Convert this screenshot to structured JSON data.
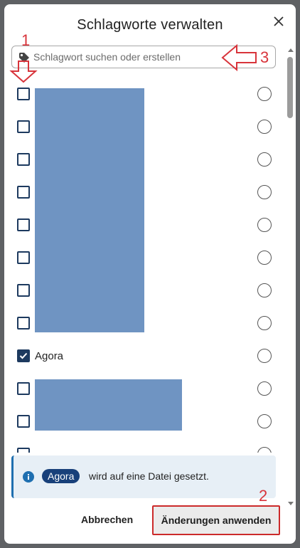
{
  "dialog": {
    "title": "Schlagworte verwalten",
    "close_icon": "close-icon"
  },
  "search": {
    "placeholder": "Schlagwort suchen oder erstellen",
    "icon": "tag-icon"
  },
  "tags": [
    {
      "label": "",
      "checked": false,
      "redacted": true
    },
    {
      "label": "",
      "checked": false,
      "redacted": true
    },
    {
      "label": "",
      "checked": false,
      "redacted": true
    },
    {
      "label": "",
      "checked": false,
      "redacted": true
    },
    {
      "label": "",
      "checked": false,
      "redacted": true
    },
    {
      "label": "",
      "checked": false,
      "redacted": true
    },
    {
      "label": "",
      "checked": false,
      "redacted": true
    },
    {
      "label": "",
      "checked": false,
      "redacted": true
    },
    {
      "label": "Agora",
      "checked": true,
      "redacted": false
    },
    {
      "label": "",
      "checked": false,
      "redacted": true
    },
    {
      "label": "",
      "checked": false,
      "redacted": true
    }
  ],
  "info": {
    "chip": "Agora",
    "text": "wird auf eine Datei gesetzt.",
    "icon": "info-icon"
  },
  "footer": {
    "cancel_label": "Abbrechen",
    "apply_label": "Änderungen anwenden"
  },
  "annotations": {
    "n1": "1",
    "n2": "2",
    "n3": "3",
    "color": "#d8343b"
  }
}
